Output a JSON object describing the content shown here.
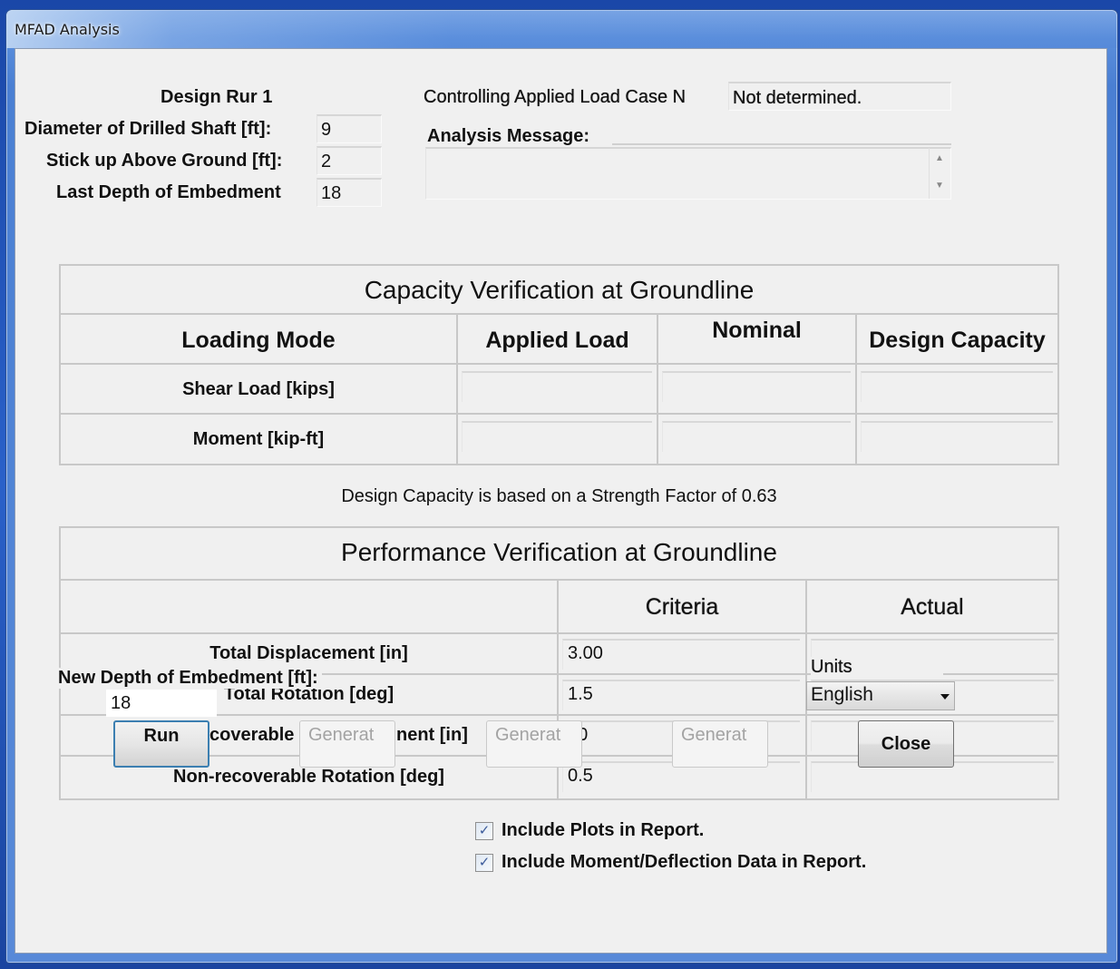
{
  "window": {
    "title": "MFAD Analysis"
  },
  "design": {
    "run_label": "Design Rur 1",
    "diameter_label": "Diameter of Drilled Shaft [ft]:",
    "diameter_value": "9",
    "stickup_label": "Stick up Above Ground [ft]:",
    "stickup_value": "2",
    "last_depth_label": "Last Depth of Embedment",
    "last_depth_value": "18"
  },
  "analysis": {
    "controlling_label": "Controlling Applied Load Case N",
    "controlling_value": "Not determined.",
    "message_label": "Analysis Message:",
    "message_value": "",
    "scroll_up_icon": "▲",
    "scroll_down_icon": "▼"
  },
  "capacity": {
    "title": "Capacity Verification at Groundline",
    "columns": [
      "Loading Mode",
      "Applied Load",
      "Nominal",
      "Design Capacity"
    ],
    "rows": [
      {
        "label": "Shear Load [kips]",
        "applied": "",
        "nominal": "",
        "design": ""
      },
      {
        "label": "Moment [kip-ft]",
        "applied": "",
        "nominal": "",
        "design": ""
      }
    ],
    "note": "Design Capacity is based on a Strength Factor of 0.63"
  },
  "performance": {
    "title": "Performance Verification at Groundline",
    "columns": [
      "",
      "Criteria",
      "Actual"
    ],
    "rows": [
      {
        "label": "Total Displacement [in]",
        "criteria": "3.00",
        "actual": ""
      },
      {
        "label": "Total Rotation [deg]",
        "criteria": "1.5",
        "actual": ""
      },
      {
        "label": "Non-recoverable Displacement [in]",
        "criteria": "0.00",
        "actual": ""
      },
      {
        "label": "Non-recoverable Rotation [deg]",
        "criteria": "0.5",
        "actual": ""
      }
    ],
    "row3_visible_left": "coverable",
    "row3_visible_mid": "nent [in]",
    "row3_visible_criteria": "00",
    "row2_visible_label": "Total Rotation [deg]"
  },
  "controls": {
    "new_depth_label": "New Depth of Embedment [ft]:",
    "new_depth_value": "18",
    "run_button": "Run",
    "generate_button_1": "Generat",
    "generate_button_2": "Generat",
    "generate_button_3": "Generat",
    "units_label": "Units",
    "units_selected": "English",
    "close_button": "Close"
  },
  "options": {
    "include_plots_label": "Include Plots in Report.",
    "include_plots_checked": true,
    "include_data_label": "Include Moment/Deflection Data in Report.",
    "include_data_checked": true,
    "check_glyph": "✓"
  }
}
